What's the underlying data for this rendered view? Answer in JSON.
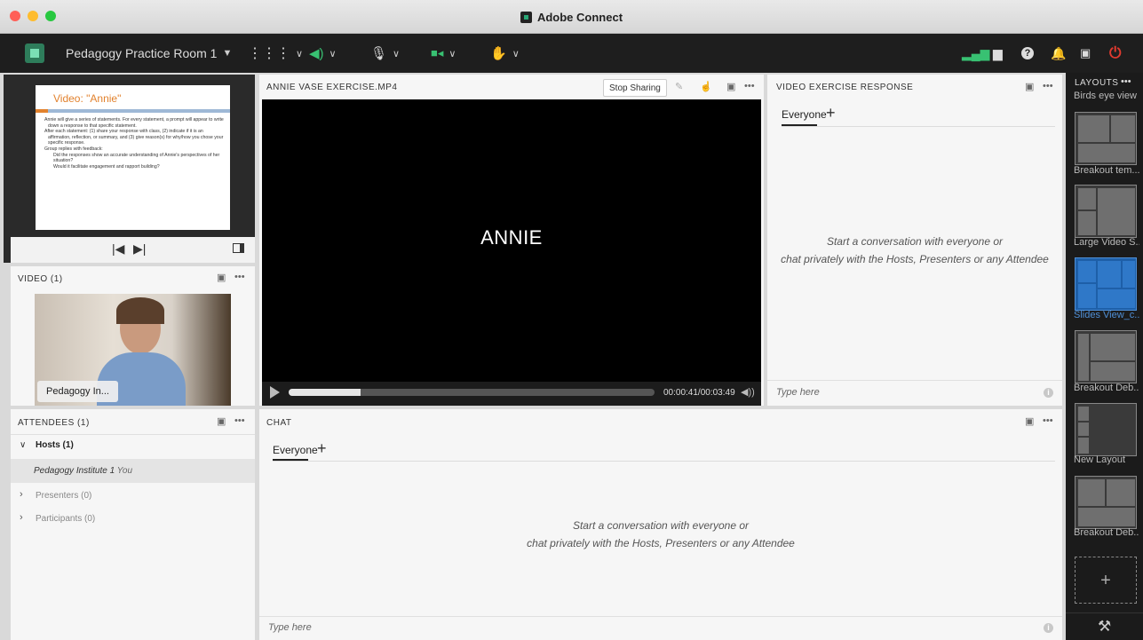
{
  "window": {
    "title": "Adobe Connect"
  },
  "toolbar": {
    "room_name": "Pedagogy Practice Room 1"
  },
  "slides": {
    "title": "Video: \"Annie\"",
    "bullets": [
      "Annie will give a series of statements. For every statement, a prompt will appear to write down a response to that specific statement.",
      "After each statement: (1) share your response with class, (2) indicate if it is an affirmation, reflection, or summary, and (3) give reason(s) for why/how you chose your specific response.",
      "Group replies with feedback:",
      "Did the responses show an accurate understanding of Annie's perspectives of her situation?",
      "Would it facilitate engagement and rapport building?"
    ]
  },
  "video_pod": {
    "title": "VIDEO (1)",
    "participant_label": "Pedagogy In..."
  },
  "attendees": {
    "title": "ATTENDEES (1)",
    "hosts": "Hosts (1)",
    "host_name": "Pedagogy Institute 1",
    "host_you": "You",
    "presenters": "Presenters (0)",
    "participants": "Participants (0)"
  },
  "share_pod": {
    "title": "ANNIE VASE EXERCISE.MP4",
    "stop_sharing": "Stop Sharing",
    "video_text": "ANNIE",
    "time": "00:00:41/00:03:49",
    "progress": 0.196
  },
  "video_response": {
    "title": "VIDEO EXERCISE RESPONSE",
    "tab": "Everyone",
    "message_line1": "Start a conversation with everyone or",
    "message_line2": "chat privately with the Hosts, Presenters or any Attendee",
    "placeholder": "Type here"
  },
  "chat": {
    "title": "CHAT",
    "tab": "Everyone",
    "message_line1": "Start a conversation with everyone or",
    "message_line2": "chat privately with the Hosts, Presenters or any Attendee",
    "placeholder": "Type here"
  },
  "layouts": {
    "title": "LAYOUTS",
    "items": [
      {
        "label": "Birds eye view"
      },
      {
        "label": "Breakout tem..."
      },
      {
        "label": "Large Video S..."
      },
      {
        "label": "Slides View_c..."
      },
      {
        "label": "Breakout Deb..."
      },
      {
        "label": "New Layout"
      },
      {
        "label": "Breakout Deb..."
      }
    ]
  },
  "colors": {
    "accent_blue": "#1e5fa8",
    "accent_green": "#2aa876",
    "danger": "#e03a2f"
  }
}
